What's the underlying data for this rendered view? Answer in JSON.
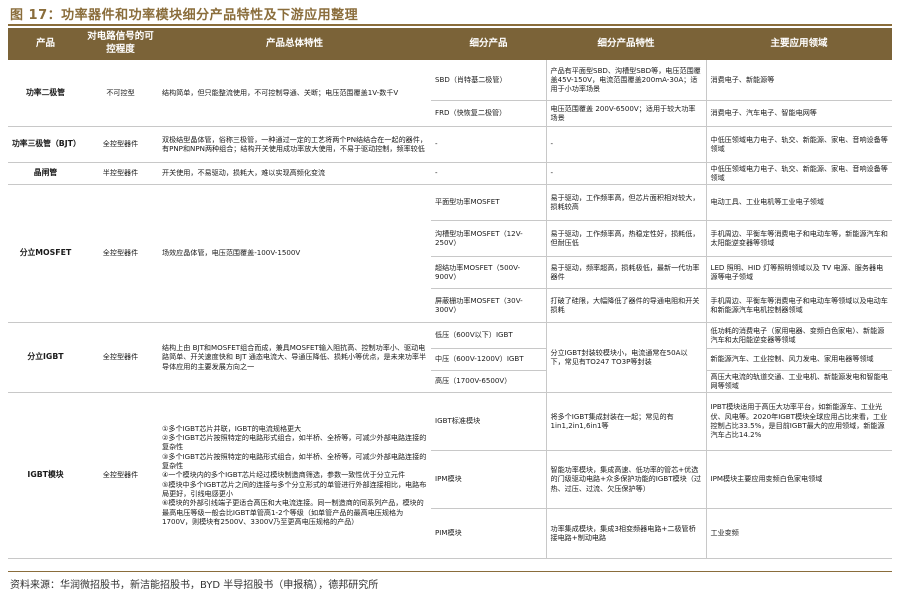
{
  "title": "图 17：功率器件和功率模块细分产品特性及下游应用整理",
  "headers": [
    "产品",
    "对电路信号的可控程度",
    "产品总体特性",
    "细分产品",
    "细分产品特性",
    "主要应用领域"
  ],
  "products": {
    "diode": {
      "name": "功率二极管",
      "control": "不可控型",
      "feature": "结构简单，但只能整流使用，不可控制导通、关断；电压范围覆盖1V-数千V",
      "subs": [
        {
          "name": "SBD（肖特基二极管）",
          "feature": "产品有平面型SBD、沟槽型SBD等，电压范围覆盖45V-150V，电流范围覆盖200mA-30A；适用于小功率场景",
          "app": "消费电子、新能源等"
        },
        {
          "name": "FRD（快恢复二极管）",
          "feature": "电压范围覆盖 200V-6500V；适用于较大功率场景",
          "app": "消费电子、汽车电子、智能电网等"
        }
      ]
    },
    "bjt": {
      "name": "功率三极管（BJT）",
      "control": "全控型器件",
      "feature": "双极结型晶体管，俗称三极管，一种通过一定的工艺将两个PN结结合在一起的器件，有PNP和NPN两种组合；结构开关使用成功率放大使用，不易于驱动控制，频率较低",
      "sub": "-",
      "subfeature": "-",
      "app": "中低压领域电力电子、轨交、新能源、家电、音响设备等领域"
    },
    "thyristor": {
      "name": "晶闸管",
      "control": "半控型器件",
      "feature": "开关使用，不易驱动，损耗大，难以实现高频化变流",
      "sub": "-",
      "subfeature": "-",
      "app": "中低压领域电力电子、轨交、新能源、家电、音响设备等领域"
    },
    "mosfet": {
      "name": "分立MOSFET",
      "control": "全控型器件",
      "feature": "场效应晶体管，电压范围覆盖-100V-1500V",
      "subs": [
        {
          "name": "平面型功率MOSFET",
          "feature": "易于驱动，工作频率高，但芯片面积相对较大，损耗较高",
          "app": "电动工具、工业电机等工业电子领域"
        },
        {
          "name": "沟槽型功率MOSFET（12V-250V）",
          "feature": "易于驱动，工作频率高，热稳定性好，损耗低，但耐压低",
          "app": "手机周边、平衡车等消费电子和电动车等，新能源汽车和太阳能逆变器等领域"
        },
        {
          "name": "超结功率MOSFET（500V-900V）",
          "feature": "易于驱动，频率超高，损耗极低，最新一代功率器件",
          "app": "LED 照明、HID 灯等照明领域以及 TV 电源、服务器电源等电子领域"
        },
        {
          "name": "屏蔽栅功率MOSFET（30V-300V）",
          "feature": "打破了硅限，大幅降低了器件的导通电阻和开关损耗",
          "app": "手机周边、平衡车等消费电子和电动车等领域以及电动车和新能源汽车电机控制器领域"
        }
      ]
    },
    "igbt": {
      "name": "分立IGBT",
      "control": "全控型器件",
      "feature": "结构上由 BJT和MOSFET组合而成，兼具MOSFET输入阻抗高、控制功率小、驱动电路简单、开关速度快和 BJT 通态电流大、导通压降低、损耗小等优点，是未来功率半导体应用的主要发展方向之一",
      "subs": [
        {
          "name": "低压（600V以下）IGBT",
          "app": "低功耗的消费电子（家用电器、变频白色家电）、新能源汽车和太阳能逆变器等领域"
        },
        {
          "name": "中压（600V-1200V）IGBT",
          "app": "新能源汽车、工业控制、风力发电、家用电器等领域"
        },
        {
          "name": "高压（1700V-6500V）",
          "app": "高压大电流的轨道交通、工业电机、新能源发电和智能电网等领域"
        }
      ],
      "subfeature": "分立IGBT封装较模块小，电流通常在50A以下，常见有TO247 TO3P等封装"
    },
    "module": {
      "name": "IGBT模块",
      "control": "全控型器件",
      "features": [
        "①多个IGBT芯片并联，IGBT的电流规格更大",
        "②多个IGBT芯片按照特定的电路形式组合，如半桥、全桥等，可减少外部电路连接的复杂性",
        "③多个IGBT芯片按照特定的电路形式组合，如半桥、全桥等，可减少外部电路连接的复杂性",
        "④一个模块内的多个IGBT芯片经过模块制造商筛选，参数一致性优于分立元件",
        "⑤模块中多个IGBT芯片之间的连接与多个分立形式的单管进行外部连接相比，电路布局更好，引线电感更小",
        "⑥模块的外部引线端子更适合高压和大电流连接。同一制造商的同系列产品，模块的最高电压等级一般会比IGBT单管高1-2个等级（如单管产品的最高电压规格为1700V，则模块有2500V、3300V乃至更高电压规格的产品）"
      ],
      "subs": [
        {
          "name": "IGBT标准模块",
          "feature": "将多个IGBT集成封装在一起；常见的有1in1,2in1,6in1等",
          "app": "IPBT模块适用于高压大功率平台，如新能源车、工业光伏、风电等。2020年IGBT模块全球应用占比来看，工业控制占比33.5%，是目前IGBT最大的应用领域，新能源汽车占比14.2%"
        },
        {
          "name": "IPM模块",
          "feature": "智能功率模块，集成高速、低功率的管芯+优选的门级驱动电路+众多保护功能的IGBT模块（过热、过压、过流、欠压保护等）",
          "app": "IPM模块主要应用变频白色家电领域"
        },
        {
          "name": "PIM模块",
          "feature": "功率集成模块，集成3相变频器电路+二极管桥接电路+制动电路",
          "app": "工业变频"
        }
      ]
    }
  },
  "source": "资料来源：华润微招股书，新洁能招股书，BYD 半导招股书（申报稿），德邦研究所"
}
